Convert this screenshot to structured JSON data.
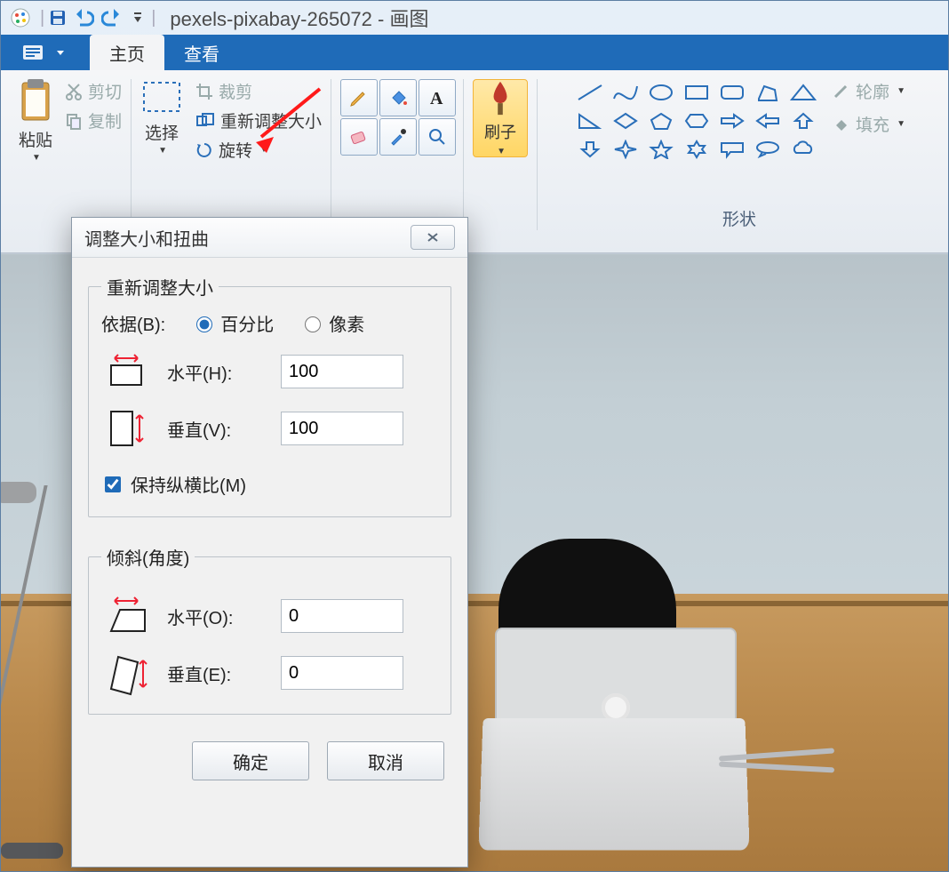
{
  "titlebar": {
    "title": "pexels-pixabay-265072 - 画图"
  },
  "tabs": {
    "file": "",
    "home": "主页",
    "view": "查看"
  },
  "ribbon": {
    "clipboard": {
      "paste": "粘贴",
      "cut": "剪切",
      "copy": "复制",
      "group": ""
    },
    "image": {
      "select": "选择",
      "crop": "裁剪",
      "resize": "重新调整大小",
      "rotate": "旋转",
      "group": ""
    },
    "tools": {
      "group": ""
    },
    "brushes": {
      "label": "刷子"
    },
    "shapes": {
      "group": "形状",
      "outline": "轮廓",
      "fill": "填充"
    }
  },
  "dialog": {
    "title": "调整大小和扭曲",
    "resize": {
      "legend": "重新调整大小",
      "by_label": "依据(B):",
      "percent": "百分比",
      "pixels": "像素",
      "h_label": "水平(H):",
      "v_label": "垂直(V):",
      "h_value": "100",
      "v_value": "100",
      "aspect": "保持纵横比(M)"
    },
    "skew": {
      "legend": "倾斜(角度)",
      "h_label": "水平(O):",
      "v_label": "垂直(E):",
      "h_value": "0",
      "v_value": "0"
    },
    "ok": "确定",
    "cancel": "取消"
  }
}
